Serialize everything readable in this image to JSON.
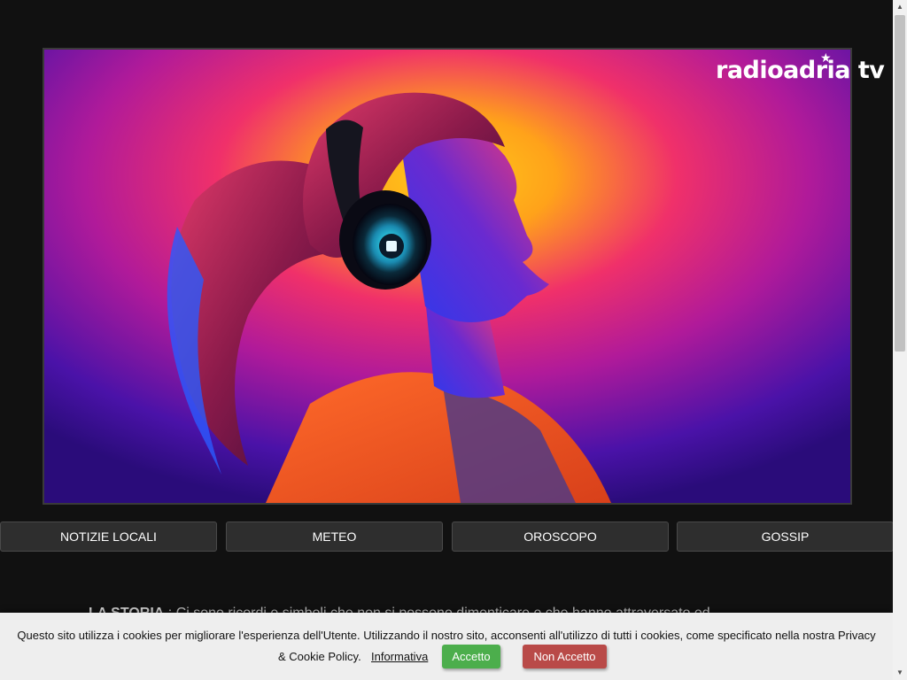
{
  "hero": {
    "logo_text": "radioadria tv",
    "image": "woman-with-headphones-photo"
  },
  "nav": {
    "items": [
      {
        "label": "NOTIZIE LOCALI"
      },
      {
        "label": "METEO"
      },
      {
        "label": "OROSCOPO"
      },
      {
        "label": "GOSSIP"
      }
    ]
  },
  "story": {
    "label": "LA STORIA",
    "text": ": Ci sono ricordi e simboli che non si possono dimenticare e che hanno attraversato ed"
  },
  "cookie": {
    "line1": "Questo sito utilizza i cookies per migliorare l'esperienza dell'Utente. Utilizzando il nostro sito, acconsenti all'utilizzo di tutti i cookies, come specificato nella nostra Privacy",
    "line2": "& Cookie Policy.",
    "info_link": "Informativa",
    "accept_label": "Accetto",
    "reject_label": "Non Accetto"
  },
  "scrollbar": {
    "up_icon": "▲",
    "down_icon": "▼"
  },
  "colors": {
    "background": "#111111",
    "accept": "#4cae4c",
    "reject": "#b94a48"
  }
}
